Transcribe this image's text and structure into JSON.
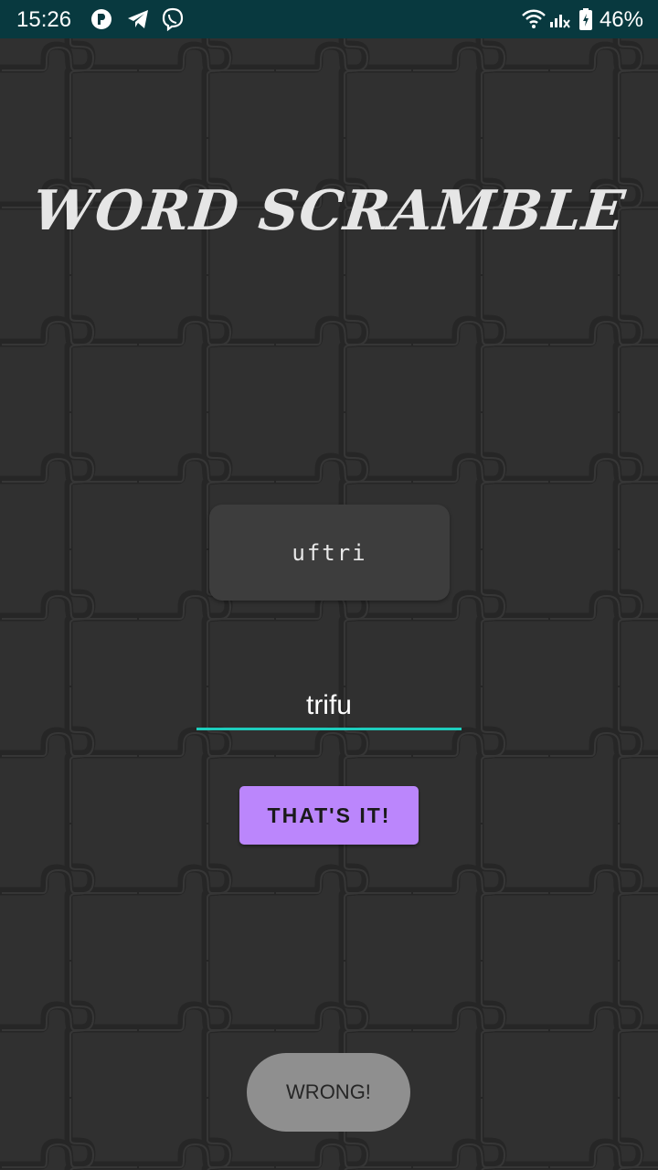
{
  "status_bar": {
    "time": "15:26",
    "battery_percent": "46%",
    "notification_icons": [
      "p-app-icon",
      "telegram-icon",
      "viber-icon"
    ],
    "system_icons": [
      "wifi-icon",
      "signal-icon",
      "battery-icon"
    ],
    "background_color": "#08393f"
  },
  "app": {
    "title": "WORD SCRAMBLE",
    "scrambled_word": "uftri",
    "answer_value": "trifu",
    "submit_label": "THAT'S IT!",
    "toast_message": "WRONG!"
  },
  "colors": {
    "background": "#2f2f2f",
    "accent_underline": "#1ecdbd",
    "button": "#bb86fc",
    "card": "#3d3d3d",
    "toast": "#8f8f8f"
  }
}
